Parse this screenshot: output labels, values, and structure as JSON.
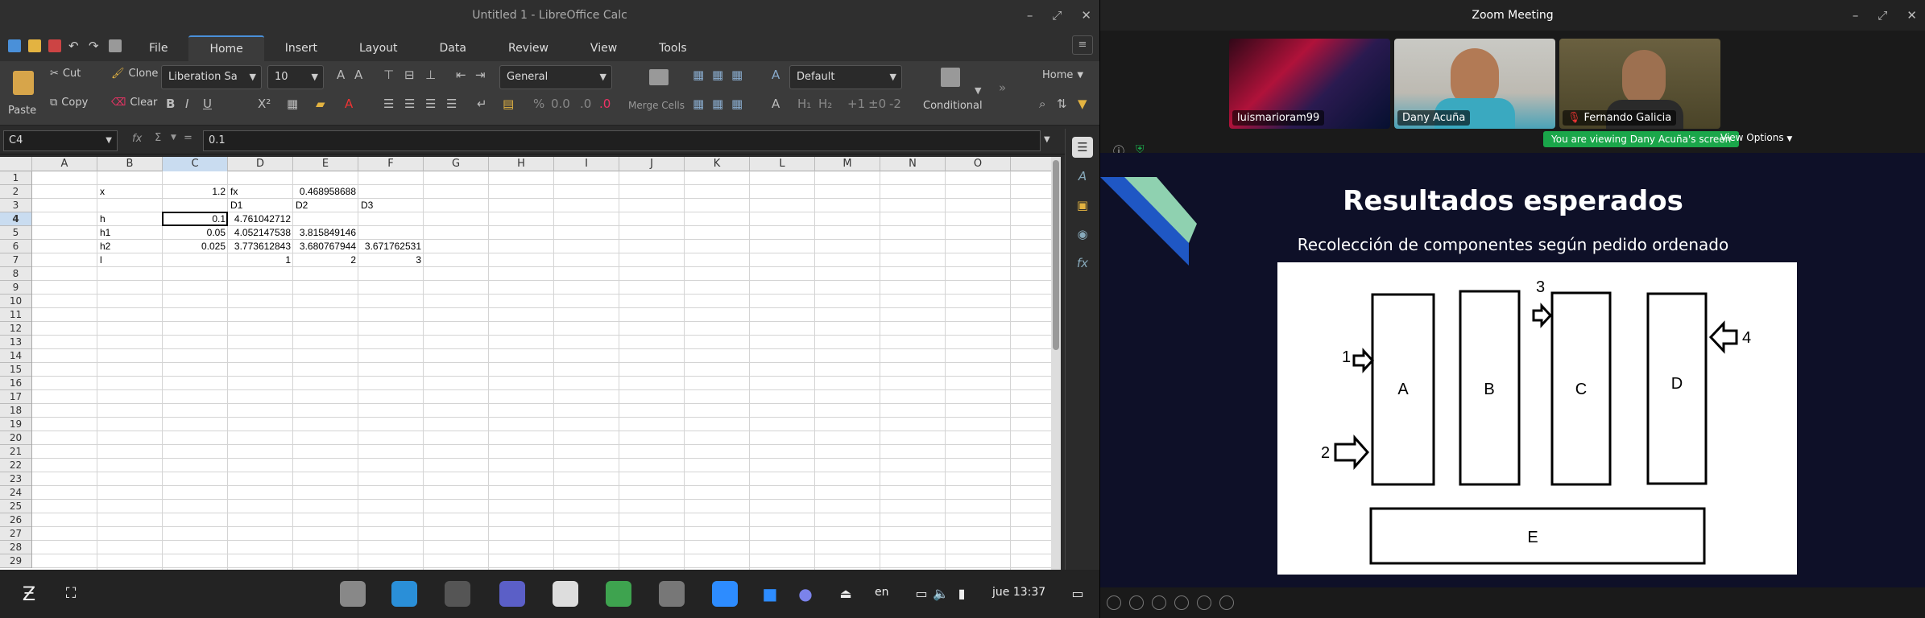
{
  "calc": {
    "window_title": "Untitled 1 - LibreOffice Calc",
    "menu_tabs": [
      "File",
      "Home",
      "Insert",
      "Layout",
      "Data",
      "Review",
      "View",
      "Tools"
    ],
    "active_tab": "Home",
    "ribbon": {
      "cut": "Cut",
      "clone": "Clone",
      "paste": "Paste",
      "copy": "Copy",
      "clear": "Clear",
      "font_name": "Liberation Sa",
      "font_size": "10",
      "number_format": "General",
      "merge_cells": "Merge Cells",
      "cell_style": "Default",
      "conditional": "Conditional",
      "home_menu": "Home",
      "bold": "B",
      "italic": "I",
      "underline": "U",
      "superscript": "X²"
    },
    "name_box": "C4",
    "formula_value": "0.1",
    "columns": [
      "A",
      "B",
      "C",
      "D",
      "E",
      "F",
      "G",
      "H",
      "I",
      "J",
      "K",
      "L",
      "M",
      "N",
      "O"
    ],
    "rows": [
      "1",
      "2",
      "3",
      "4",
      "5",
      "6",
      "7",
      "8",
      "9",
      "10",
      "11",
      "12",
      "13",
      "14",
      "15",
      "16",
      "17",
      "18",
      "19",
      "20",
      "21",
      "22",
      "23",
      "24",
      "25",
      "26",
      "27",
      "28",
      "29"
    ],
    "cells": {
      "B2": "x",
      "C2": "1.2",
      "D2": "fx",
      "E2": "0.468958688",
      "D3": "D1",
      "E3": "D2",
      "F3": "D3",
      "B4": "h",
      "C4": "0.1",
      "D4": "4.761042712",
      "B5": "h1",
      "C5": "0.05",
      "D5": "4.052147538",
      "E5": "3.815849146",
      "B6": "h2",
      "C6": "0.025",
      "D6": "3.773612843",
      "E6": "3.680767944",
      "F6": "3.671762531",
      "B7": "l",
      "D7": "1",
      "E7": "2",
      "F7": "3"
    },
    "taskbar": {
      "lang": "en",
      "clock": "jue 13:37"
    }
  },
  "zoom": {
    "window_title": "Zoom Meeting",
    "participants": [
      {
        "name": "luismarioram99",
        "muted": false
      },
      {
        "name": "Dany Acuña",
        "muted": false
      },
      {
        "name": "Fernando Galicia",
        "muted": true
      }
    ],
    "viewing_banner": "You are viewing Dany Acuña's screen",
    "view_options": "View Options",
    "slide": {
      "title": "Resultados esperados",
      "subtitle": "Recolección de componentes según pedido ordenado",
      "boxes": [
        "A",
        "B",
        "C",
        "D",
        "E"
      ],
      "arrows": [
        "1",
        "2",
        "3",
        "4"
      ]
    }
  },
  "colors": {
    "selection_blue": "#c9dcf0",
    "zoom_green": "#1aa64a",
    "slide_bg": "#0e1028",
    "accent_teal": "#8fd1b0",
    "accent_blue": "#1f57c4"
  }
}
